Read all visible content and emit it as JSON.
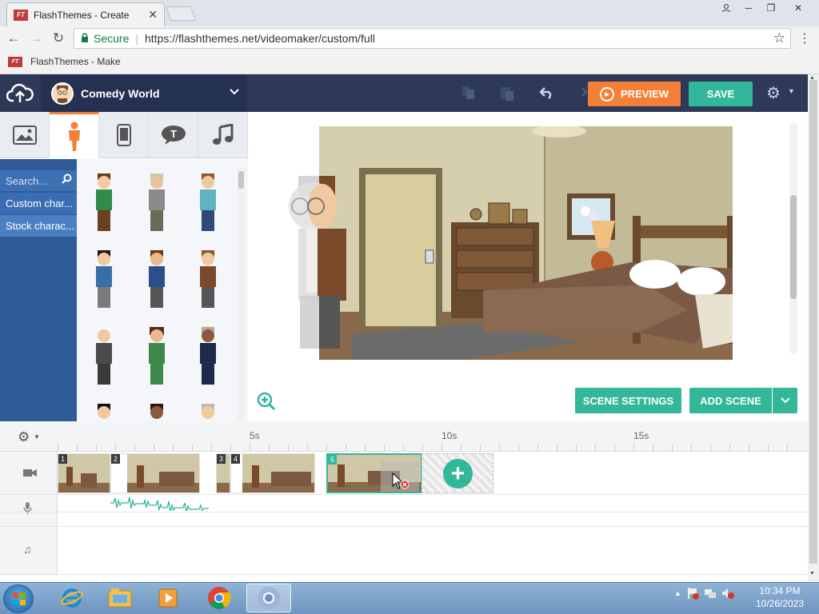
{
  "browser": {
    "tab_title": "FlashThemes - Create",
    "tab_favicon_text": "FT",
    "secure_label": "Secure",
    "url": "https://flashthemes.net/videomaker/custom/full",
    "bookmark_label": "FlashThemes - Make"
  },
  "header": {
    "theme_name": "Comedy World",
    "preview_label": "PREVIEW",
    "save_label": "SAVE"
  },
  "sidebar": {
    "search_placeholder": "Search...",
    "categories": [
      {
        "label": "Custom char..."
      },
      {
        "label": "Stock charac..."
      }
    ]
  },
  "stage": {
    "scene_settings_label": "SCENE SETTINGS",
    "add_scene_label": "ADD SCENE"
  },
  "timeline": {
    "ticks": [
      "5s",
      "10s",
      "15s"
    ],
    "scenes": [
      {
        "num": "1"
      },
      {
        "num": "2"
      },
      {
        "num": "3"
      },
      {
        "num": "4"
      },
      {
        "num": "5"
      }
    ]
  },
  "taskbar": {
    "time": "10:34 PM",
    "date": "10/26/2023"
  },
  "colors": {
    "accent_orange": "#f47f36",
    "accent_teal": "#32b79a",
    "header_navy": "#2e3957",
    "sidebar_blue": "#2f5b99"
  }
}
